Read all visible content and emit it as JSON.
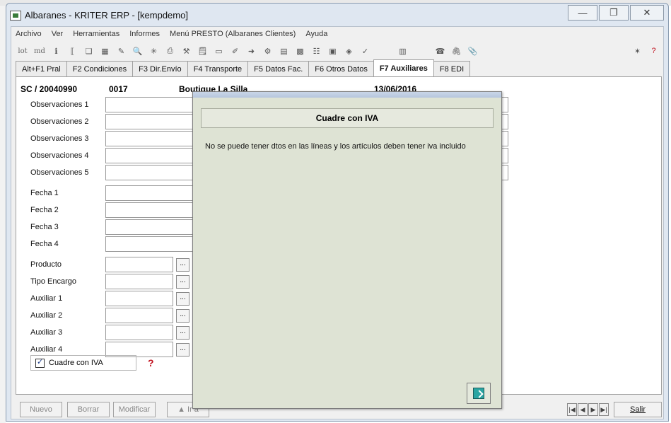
{
  "window": {
    "title": "Albaranes - KRITER ERP -  [kempdemo]",
    "min_icon": "minimize-icon",
    "max_icon": "maximize-icon",
    "close_icon": "close-icon"
  },
  "menu": [
    "Archivo",
    "Ver",
    "Herramientas",
    "Informes",
    "Menú PRESTO (Albaranes Clientes)",
    "Ayuda"
  ],
  "toolbar": {
    "lot_label": "lot",
    "md_label": "md"
  },
  "tabs": [
    {
      "label": "Alt+F1 Pral"
    },
    {
      "label": "F2 Condiciones"
    },
    {
      "label": "F3 Dir.Envío"
    },
    {
      "label": "F4 Transporte"
    },
    {
      "label": "F5 Datos Fac."
    },
    {
      "label": "F6 Otros Datos"
    },
    {
      "label": "F7 Auxiliares",
      "active": true
    },
    {
      "label": "F8 EDI"
    }
  ],
  "header": {
    "doc": "SC / 20040990",
    "code": "0017",
    "client": "Boutique La Silla",
    "date": "13/06/2016"
  },
  "fields": {
    "obs1": "Observaciones 1",
    "obs2": "Observaciones 2",
    "obs3": "Observaciones 3",
    "obs4": "Observaciones 4",
    "obs5": "Observaciones 5",
    "fecha1": "Fecha 1",
    "fecha2": "Fecha 2",
    "fecha3": "Fecha 3",
    "fecha4": "Fecha 4",
    "producto": "Producto",
    "tipo_encargo": "Tipo Encargo",
    "aux1": "Auxiliar 1",
    "aux2": "Auxiliar 2",
    "aux3": "Auxiliar 3",
    "aux4": "Auxiliar 4",
    "ellipsis": "..."
  },
  "checkbox": {
    "label": "Cuadre con IVA",
    "checked": true
  },
  "bottom": {
    "nuevo": "Nuevo",
    "borrar": "Borrar",
    "modificar": "Modificar",
    "ir": "▲ Ir a",
    "salir": "Salir"
  },
  "dialog": {
    "heading": "Cuadre con IVA",
    "message": "No se puede tener dtos en las líneas y los artículos deben tener iva incluido",
    "exit_icon": "exit-door-icon"
  }
}
